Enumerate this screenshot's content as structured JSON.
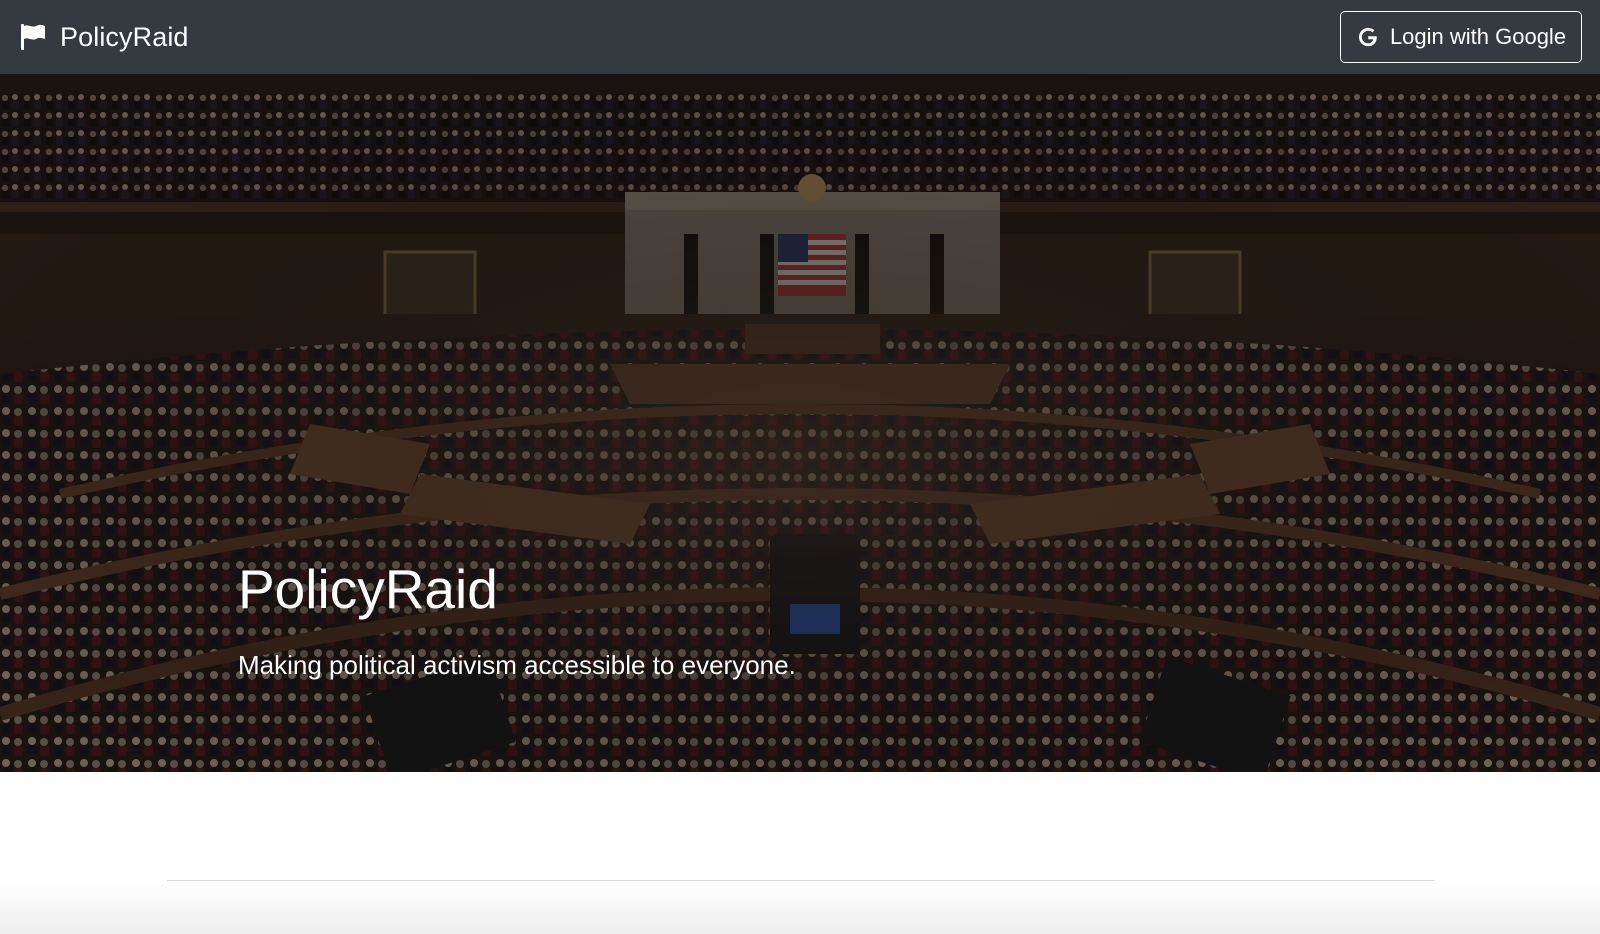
{
  "navbar": {
    "brand_icon": "flag-icon",
    "brand_name": "PolicyRaid",
    "login_icon": "google-g-icon",
    "login_label": "Login with Google",
    "background_color": "#343a40"
  },
  "hero": {
    "background_image": "house-chamber-photo",
    "title": "PolicyRaid",
    "subtitle": "Making political activism accessible to everyone."
  }
}
